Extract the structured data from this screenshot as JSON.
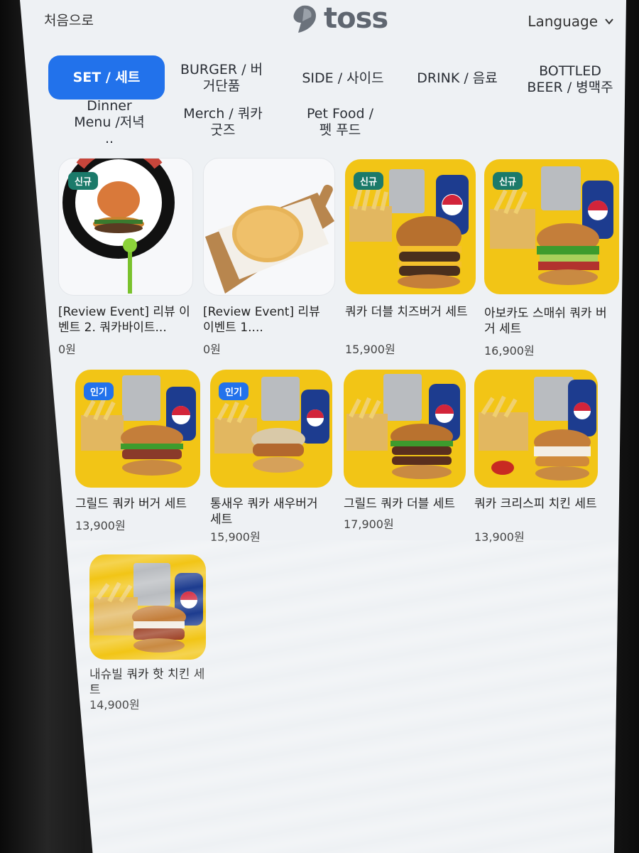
{
  "header": {
    "home_label": "처음으로",
    "logo_text": "toss",
    "language_label": "Language"
  },
  "tabs": [
    {
      "label": "SET / 세트",
      "active": true
    },
    {
      "label": "BURGER / 버거단품",
      "active": false
    },
    {
      "label": "SIDE / 사이드",
      "active": false
    },
    {
      "label": "DRINK / 음료",
      "active": false
    },
    {
      "label": "BOTTLED BEER / 병맥주",
      "active": false
    },
    {
      "label": "Dinner Menu /저녁 ..",
      "active": false
    },
    {
      "label": "Merch / 쿼카 굿즈",
      "active": false
    },
    {
      "label": "Pet Food / 펫 푸드",
      "active": false
    }
  ],
  "products": [
    {
      "name": "[Review Event] 리뷰 이벤트 2. 쿼카바이트...",
      "price": "0원",
      "badge": "신규",
      "image": "quokka-bite-logo"
    },
    {
      "name": "[Review Event] 리뷰이벤트 1....",
      "price": "0원",
      "badge": "",
      "image": "hash-brown"
    },
    {
      "name": "쿼카 더블 치즈버거 세트",
      "price": "15,900원",
      "badge": "신규",
      "image": "double-cheeseburger-set"
    },
    {
      "name": "아보카도 스매쉬 쿼카 버거 세트",
      "price": "16,900원",
      "badge": "신규",
      "image": "avocado-burger-set"
    },
    {
      "name": "그릴드 쿼카 버거 세트",
      "price": "13,900원",
      "badge": "인기",
      "image": "grilled-burger-set"
    },
    {
      "name": "통새우 쿼카 새우버거 세트",
      "price": "15,900원",
      "badge": "인기",
      "image": "shrimp-burger-set"
    },
    {
      "name": "그릴드 쿼카 더블 세트",
      "price": "17,900원",
      "badge": "",
      "image": "grilled-double-set"
    },
    {
      "name": "쿼카 크리스피 치킨 세트",
      "price": "13,900원",
      "badge": "",
      "image": "crispy-chicken-set"
    },
    {
      "name": "내슈빌 쿼카 핫 치킨 세트",
      "price": "14,900원",
      "badge": "",
      "image": "nashville-hot-chicken-set"
    }
  ],
  "colors": {
    "accent": "#2272eb",
    "badge_new": "#1b7a6a",
    "card_yellow": "#f2c516",
    "pepsi_blue": "#1d3c8f"
  }
}
